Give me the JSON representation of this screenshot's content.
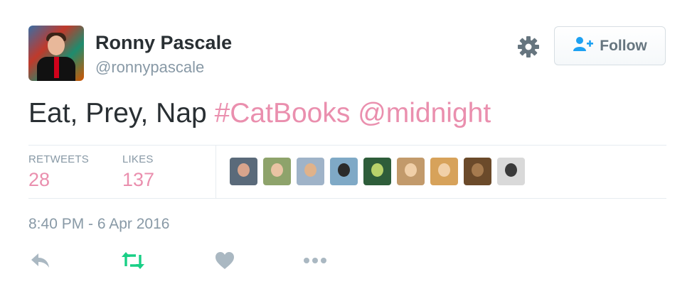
{
  "author": {
    "name": "Ronny Pascale",
    "handle": "@ronnypascale",
    "avatar_icon": "user-avatar"
  },
  "header": {
    "settings_icon": "gear-icon",
    "follow_label": "Follow",
    "follow_icon": "add-user-icon"
  },
  "tweet": {
    "text": "Eat, Prey, Nap ",
    "hashtag": "#CatBooks",
    "mention": "@midnight",
    "link_color": "#ea8fae"
  },
  "stats": {
    "retweets_label": "RETWEETS",
    "retweets_count": "28",
    "likes_label": "LIKES",
    "likes_count": "137",
    "liker_avatars": [
      {
        "name": "liker-1",
        "bg": "#5a6a7a",
        "face": "#d8a48c"
      },
      {
        "name": "liker-2",
        "bg": "#8ea36b",
        "face": "#e9c3a3"
      },
      {
        "name": "liker-3",
        "bg": "#9fb3c8",
        "face": "#e0b28a"
      },
      {
        "name": "liker-4",
        "bg": "#7fa9c6",
        "face": "#2b2b2b"
      },
      {
        "name": "liker-5",
        "bg": "#2e5d3a",
        "face": "#b8d26a"
      },
      {
        "name": "liker-6",
        "bg": "#c29a6b",
        "face": "#f0cfa8"
      },
      {
        "name": "liker-7",
        "bg": "#d7a25a",
        "face": "#f1d0a8"
      },
      {
        "name": "liker-8",
        "bg": "#6b4a2a",
        "face": "#a57a4e"
      },
      {
        "name": "liker-9",
        "bg": "#d9d9d9",
        "face": "#3a3a3a"
      }
    ]
  },
  "meta": {
    "timestamp": "8:40 PM - 6 Apr 2016"
  },
  "actions": [
    {
      "name": "reply",
      "icon": "reply-icon",
      "color": "#aab8c2"
    },
    {
      "name": "retweet",
      "icon": "retweet-icon",
      "color": "#19cf86"
    },
    {
      "name": "like",
      "icon": "heart-icon",
      "color": "#aab8c2"
    },
    {
      "name": "more",
      "icon": "more-icon",
      "color": "#aab8c2"
    }
  ]
}
